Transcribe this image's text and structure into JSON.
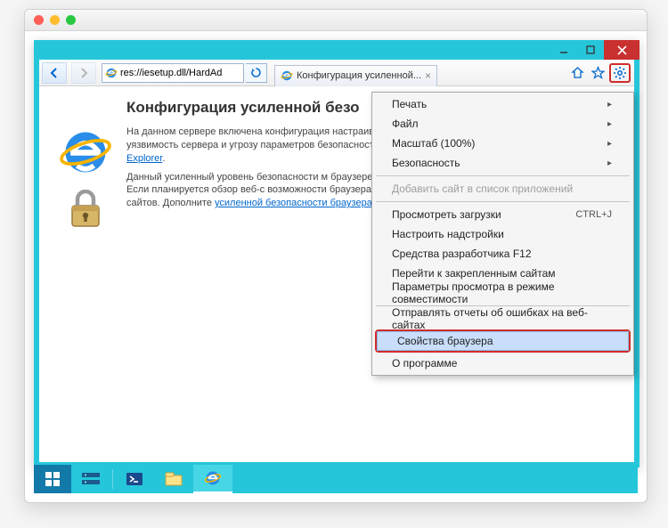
{
  "address_url": "res://iesetup.dll/HardAd",
  "tab": {
    "label": "Конфигурация усиленной..."
  },
  "content": {
    "title": "Конфигурация усиленной безо",
    "para1": "На данном сервере включена конфигурация настраивает несколько определяющих пара она уменьшает уязвимость сервера и угрозу параметров безопасности данной конфигура",
    "link1": "безопасности браузера Internet Explorer",
    "para2": "Данный усиленный уровень безопасности м браузере Internet Explorer и ограничить дост UNC-именем. Если планируется обзор веб-с возможности браузера Internet Explorer, то с интрасети или надежных сайтов. Дополните",
    "link2": "усиленной безопасности браузера Internet E"
  },
  "menu": {
    "print": "Печать",
    "file": "Файл",
    "zoom": "Масштаб (100%)",
    "security": "Безопасность",
    "add_site": "Добавить сайт в список приложений",
    "downloads": "Просмотреть загрузки",
    "downloads_shortcut": "CTRL+J",
    "addons": "Настроить надстройки",
    "devtools": "Средства разработчика F12",
    "pinned": "Перейти к закрепленным сайтам",
    "compat": "Параметры просмотра в режиме совместимости",
    "report": "Отправлять отчеты об ошибках на веб-сайтах",
    "options": "Свойства браузера",
    "about": "О программе"
  }
}
